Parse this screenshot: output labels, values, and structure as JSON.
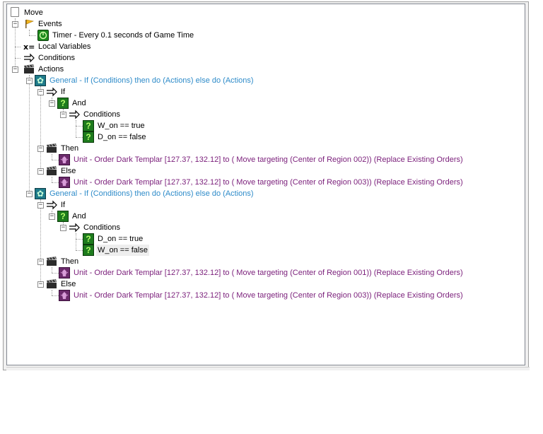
{
  "tree": {
    "root": "Move",
    "events_label": "Events",
    "event_timer": "Timer - Every 0.1 seconds of Game Time",
    "local_variables": "Local Variables",
    "conditions_label": "Conditions",
    "actions_label": "Actions",
    "general_1": "General - If (Conditions) then do (Actions) else do (Actions)",
    "if_1": "If",
    "and_1": "And",
    "conditions_1": "Conditions",
    "cond_w_true": "W_on == true",
    "cond_d_false": "D_on == false",
    "then_1": "Then",
    "unit_1_then": "Unit - Order Dark Templar [127.37, 132.12] to ( Move targeting (Center of Region 002)) (Replace Existing Orders)",
    "else_1": "Else",
    "unit_1_else": "Unit - Order Dark Templar [127.37, 132.12] to ( Move targeting (Center of Region 003)) (Replace Existing Orders)",
    "general_2": "General - If (Conditions) then do (Actions) else do (Actions)",
    "if_2": "If",
    "and_2": "And",
    "conditions_2": "Conditions",
    "cond_d_true": "D_on == true",
    "cond_w_false": "W_on == false",
    "then_2": "Then",
    "unit_2_then": "Unit - Order Dark Templar [127.37, 132.12] to ( Move targeting (Center of Region 001)) (Replace Existing Orders)",
    "else_2": "Else",
    "unit_2_else": "Unit - Order Dark Templar [127.37, 132.12] to ( Move targeting (Center of Region 003)) (Replace Existing Orders)"
  },
  "colors": {
    "general": "#2e8bc9",
    "unit_action": "#7a1e7a",
    "condition_icon": "#1d7b1d"
  },
  "icons": {
    "root": "document-icon",
    "events": "flag-icon",
    "timer": "timer-icon",
    "local_variables": "variable-icon",
    "conditions": "arrow-icon",
    "actions": "clapperboard-icon",
    "general": "gear-icon",
    "and": "question-icon",
    "unit": "unit-icon"
  }
}
